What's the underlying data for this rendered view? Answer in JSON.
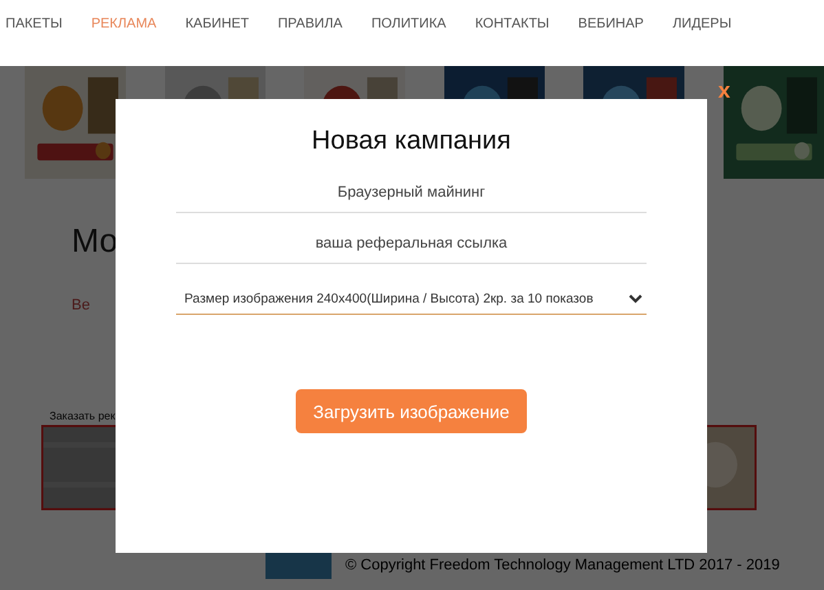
{
  "nav": {
    "items": [
      {
        "label": "ПАКЕТЫ",
        "selected": false
      },
      {
        "label": "РЕКЛАМА",
        "selected": true
      },
      {
        "label": "КАБИНЕТ",
        "selected": false
      },
      {
        "label": "ПРАВИЛА",
        "selected": false
      },
      {
        "label": "ПОЛИТИКА",
        "selected": false
      },
      {
        "label": "КОНТАКТЫ",
        "selected": false
      },
      {
        "label": "ВЕБИНАР",
        "selected": false
      },
      {
        "label": "ЛИДЕРЫ",
        "selected": false
      }
    ]
  },
  "background": {
    "heading": "Мо",
    "link": "Ве",
    "order_label": "Заказать рек",
    "footer": {
      "copyright": "© Copyright Freedom Technology Management LTD 2017 - 2019"
    }
  },
  "modal": {
    "close": "x",
    "title": "Новая кампания",
    "fields": [
      {
        "placeholder": "Браузерный майнинг"
      },
      {
        "placeholder": "ваша реферальная ссылка"
      }
    ],
    "select": {
      "value": "Размер изображения 240x400(Ширина / Высота) 2кр. за 10 показов"
    },
    "button": "Загрузить изображение"
  }
}
